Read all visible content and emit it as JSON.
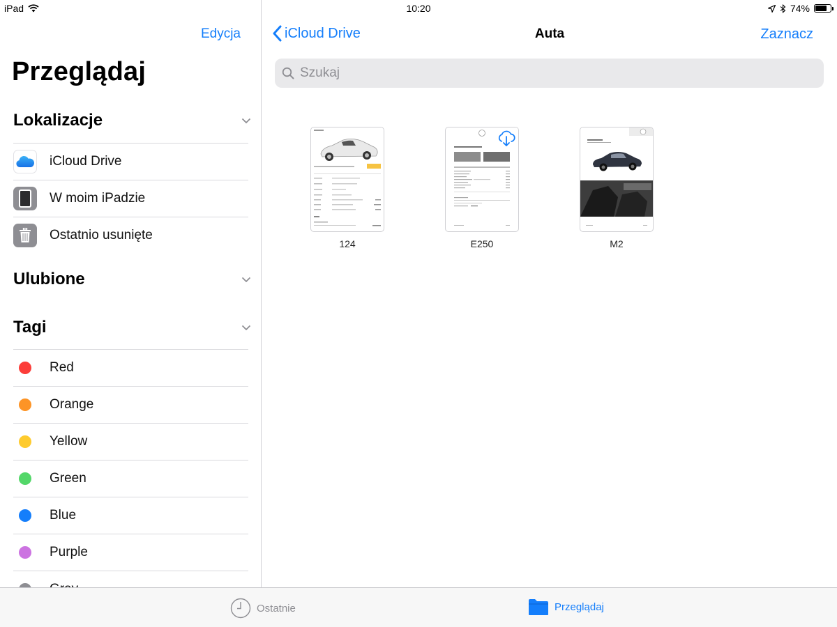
{
  "status": {
    "device": "iPad",
    "time": "10:20",
    "battery_percent": "74%",
    "battery_level": 0.74
  },
  "sidebar": {
    "edit_label": "Edycja",
    "title": "Przeglądaj",
    "sections": {
      "locations": "Lokalizacje",
      "favorites": "Ulubione",
      "tags": "Tagi"
    },
    "locations": [
      {
        "label": "iCloud Drive",
        "icon": "icloud-icon"
      },
      {
        "label": "W moim iPadzie",
        "icon": "ipad-icon"
      },
      {
        "label": "Ostatnio usunięte",
        "icon": "trash-icon"
      }
    ],
    "tags": [
      {
        "label": "Red",
        "color": "#fc3d39"
      },
      {
        "label": "Orange",
        "color": "#fd9426"
      },
      {
        "label": "Yellow",
        "color": "#fecb2e"
      },
      {
        "label": "Green",
        "color": "#53d769"
      },
      {
        "label": "Blue",
        "color": "#147efb"
      },
      {
        "label": "Purple",
        "color": "#cc73e1"
      },
      {
        "label": "Gray",
        "color": "#8e8e93"
      }
    ]
  },
  "nav": {
    "back_label": "iCloud Drive",
    "title": "Auta",
    "select_label": "Zaznacz"
  },
  "search": {
    "placeholder": "Szukaj"
  },
  "files": [
    {
      "name": "124"
    },
    {
      "name": "E250",
      "status_icon": "cloud-download-icon"
    },
    {
      "name": "M2"
    }
  ],
  "tabbar": {
    "recents": "Ostatnie",
    "browse": "Przeglądaj"
  },
  "colors": {
    "accent": "#147efb",
    "tab_inactive": "#8e8e93"
  }
}
